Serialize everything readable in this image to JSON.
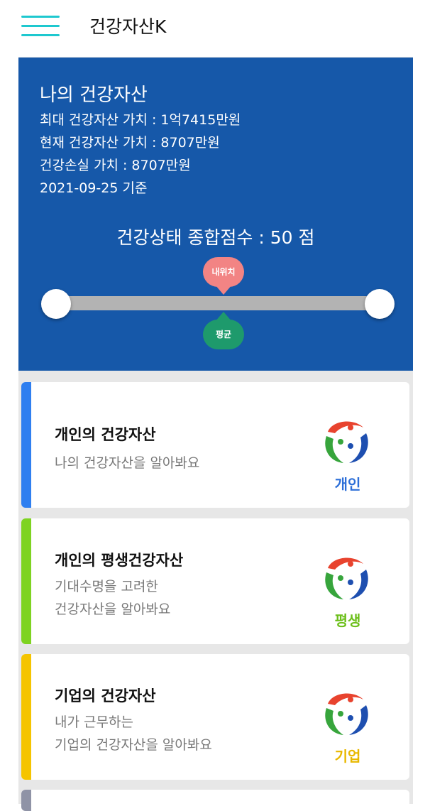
{
  "header": {
    "title": "건강자산K"
  },
  "hero": {
    "title": "나의 건강자산",
    "max_value": "최대 건강자산 가치 : 1억7415만원",
    "current_value": "현재 건강자산 가치 : 8707만원",
    "loss_value": "건강손실 가치 : 8707만원",
    "date": "2021-09-25 기준",
    "score_text": "건강상태 종합점수 : 50 점",
    "score": 50,
    "my_position_label": "내위치",
    "average_label": "평균"
  },
  "cards": [
    {
      "title": "개인의 건강자산",
      "desc1": "나의 건강자산을 알아봐요",
      "desc2": "",
      "tag": "개인",
      "color": "#2f7ff0",
      "tag_color": "#2d6fd8",
      "icon": "health-logo-icon"
    },
    {
      "title": "개인의 평생건강자산",
      "desc1": "기대수명을 고려한",
      "desc2": "건강자산을 알아봐요",
      "tag": "평생",
      "color": "#7ed321",
      "tag_color": "#6cbf1a",
      "icon": "health-logo-icon"
    },
    {
      "title": "기업의 건강자산",
      "desc1": "내가 근무하는",
      "desc2": "기업의 건강자산을 알아봐요",
      "tag": "기업",
      "color": "#f5c400",
      "tag_color": "#e8b800",
      "icon": "health-logo-icon"
    },
    {
      "color": "#8f93a6"
    }
  ],
  "colors": {
    "hero_bg": "#1658a9",
    "accent": "#1ec8cf"
  }
}
